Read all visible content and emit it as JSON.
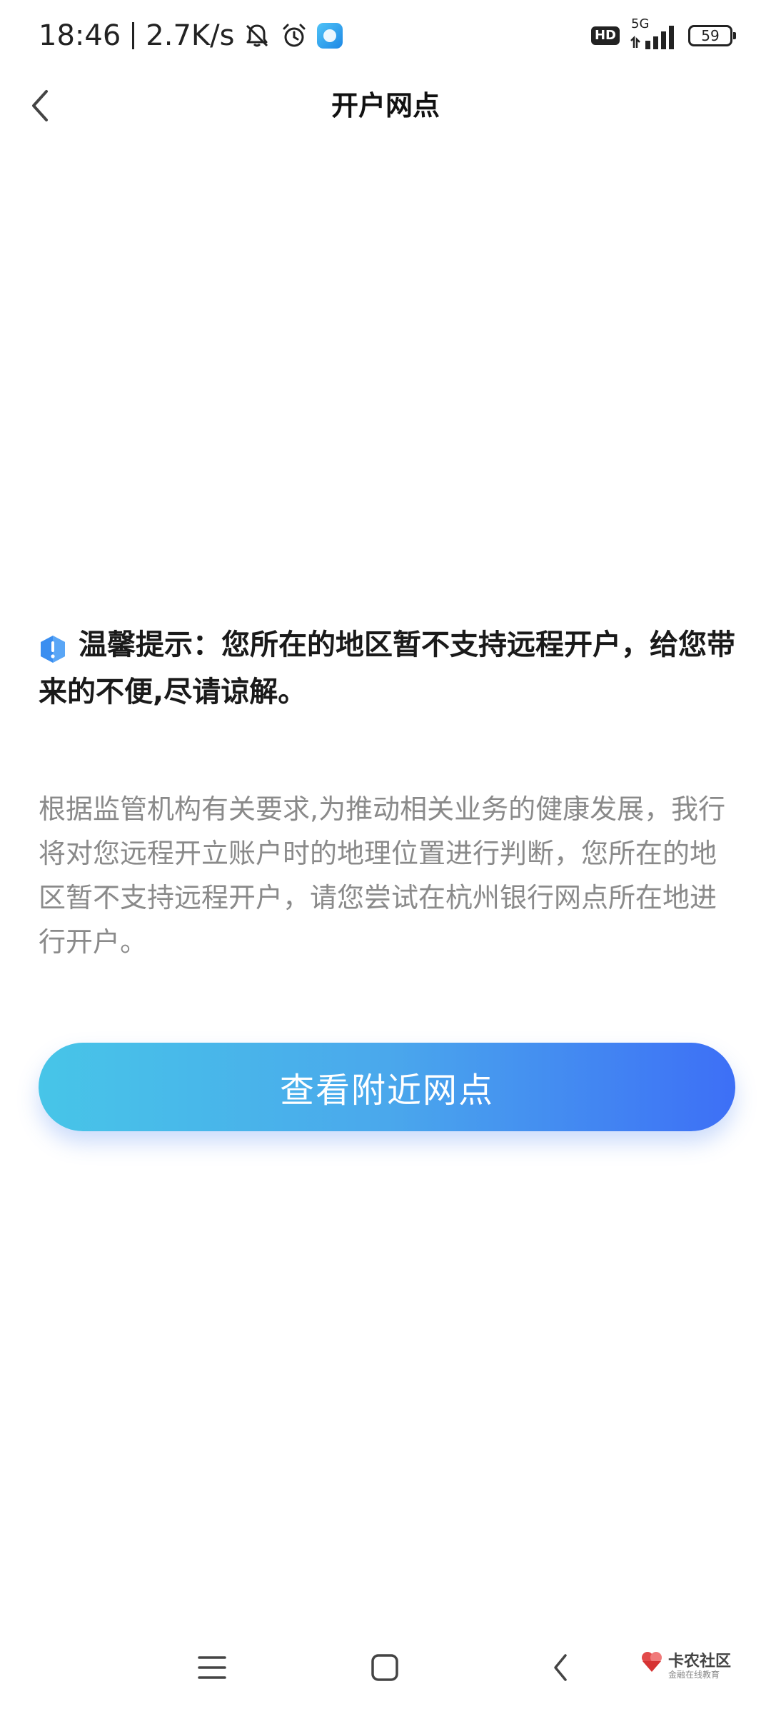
{
  "status_bar": {
    "time": "18:46",
    "net_speed": "2.7K/s",
    "network_type": "5G",
    "hd_badge": "HD",
    "battery_level": "59",
    "icons": [
      "bell-off-icon",
      "alarm-clock-icon",
      "app-notification-icon",
      "hd-icon",
      "signal-icon",
      "battery-icon"
    ]
  },
  "nav": {
    "title": "开户网点",
    "back_icon": "chevron-left-icon"
  },
  "notice": {
    "icon": "info-shield-icon",
    "text": "温馨提示：您所在的地区暂不支持远程开户，给您带来的不便,尽请谅解。"
  },
  "description": {
    "text": "根据监管机构有关要求,为推动相关业务的健康发展，我行将对您远程开立账户时的地理位置进行判断，您所在的地区暂不支持远程开户，请您尝试在杭州银行网点所在地进行开户。"
  },
  "primary_button": {
    "label": "查看附近网点"
  },
  "system_nav": {
    "icons": [
      "menu-icon",
      "home-square-icon",
      "back-chevron-icon"
    ]
  },
  "watermark": {
    "text": "卡农社区",
    "subtext": "金融在线教育"
  },
  "colors": {
    "button_start": "#47c5e8",
    "button_end": "#3d6ff6",
    "description_text": "#8a8a8a",
    "info_icon": "#3a8ef0"
  }
}
